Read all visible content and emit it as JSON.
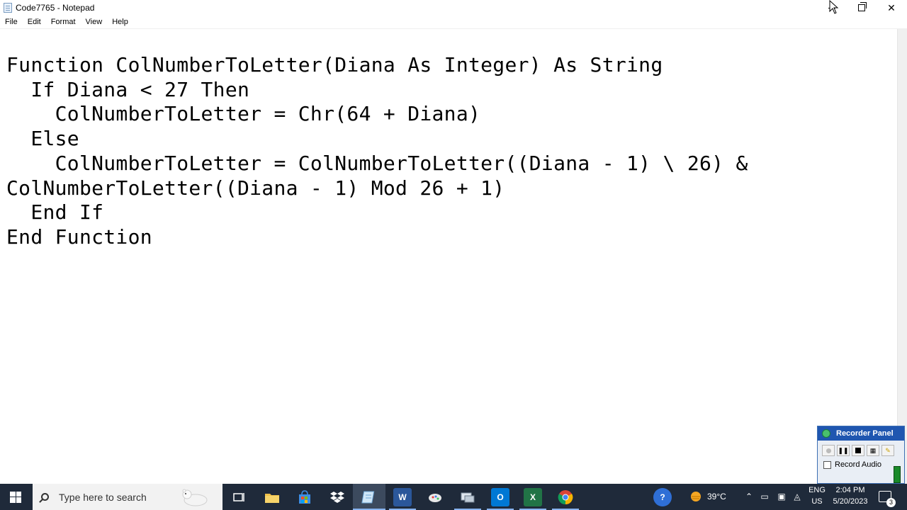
{
  "window": {
    "title": "Code7765 - Notepad"
  },
  "menu": [
    "File",
    "Edit",
    "Format",
    "View",
    "Help"
  ],
  "editor": {
    "content": "Function ColNumberToLetter(Diana As Integer) As String\n  If Diana < 27 Then\n    ColNumberToLetter = Chr(64 + Diana)\n  Else\n    ColNumberToLetter = ColNumberToLetter((Diana - 1) \\ 26) &\nColNumberToLetter((Diana - 1) Mod 26 + 1)\n  End If\nEnd Function"
  },
  "recorder": {
    "title": "Recorder Panel",
    "audio_label": "Record Audio"
  },
  "taskbar": {
    "search_placeholder": "Type here to search",
    "apps": [
      "task-view",
      "file-explorer",
      "store",
      "dropbox",
      "notepad",
      "word",
      "paint",
      "remote-desktop",
      "outlook",
      "excel",
      "chrome"
    ],
    "weather": "39°C",
    "language": "ENG",
    "region": "US",
    "time": "2:04 PM",
    "date": "5/20/2023",
    "notification_count": "3"
  },
  "colors": {
    "taskbar": "#1f2a3a",
    "recorder_header": "#1f56b0",
    "word": "#2b579a",
    "excel": "#217346",
    "outlook": "#0078d4"
  }
}
